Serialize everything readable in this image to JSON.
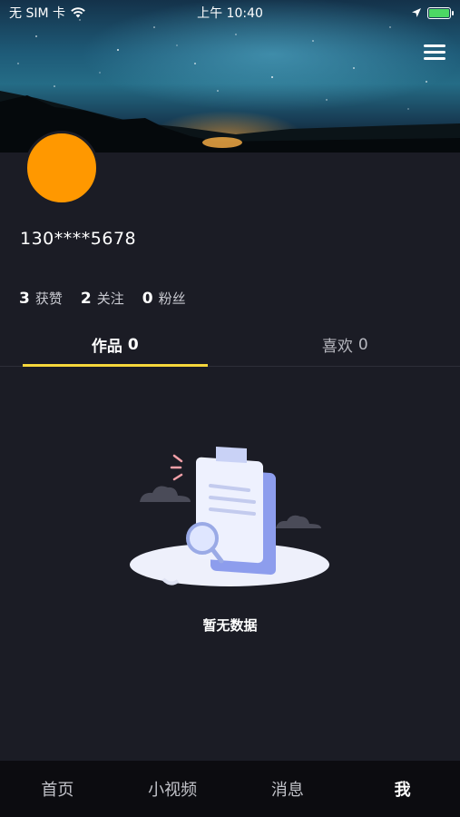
{
  "status_bar": {
    "carrier": "无 SIM 卡",
    "time": "上午 10:40"
  },
  "profile": {
    "phone": "130****5678",
    "avatar_color": "#ff9800"
  },
  "stats": [
    {
      "value": "3",
      "label": "获赞"
    },
    {
      "value": "2",
      "label": "关注"
    },
    {
      "value": "0",
      "label": "粉丝"
    }
  ],
  "tabs": [
    {
      "label": "作品",
      "count": "0",
      "active": true
    },
    {
      "label": "喜欢",
      "count": "0",
      "active": false
    }
  ],
  "empty_state": {
    "text": "暂无数据"
  },
  "bottom_nav": [
    {
      "label": "首页",
      "active": false
    },
    {
      "label": "小视频",
      "active": false
    },
    {
      "label": "消息",
      "active": false
    },
    {
      "label": "我",
      "active": true
    }
  ],
  "colors": {
    "accent": "#f5d63b",
    "background": "#1b1c25",
    "battery": "#4cd964"
  }
}
